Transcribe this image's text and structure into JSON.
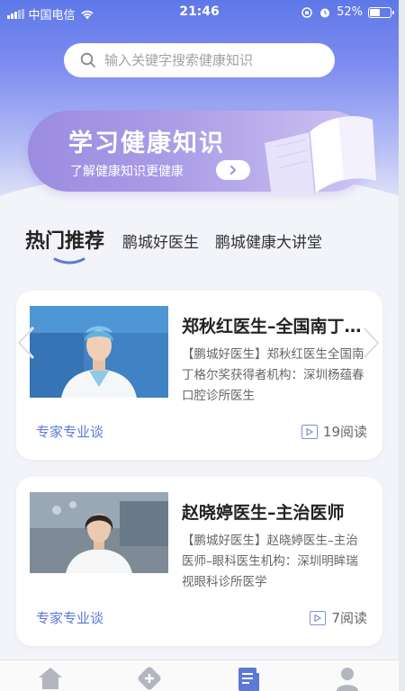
{
  "status_bar": {
    "carrier": "中国电信",
    "time": "21:46",
    "battery": "52%",
    "battery_level": 0.52
  },
  "search": {
    "placeholder": "输入关键字搜索健康知识"
  },
  "banner": {
    "title": "学习健康知识",
    "subtitle": "了解健康知识更健康"
  },
  "tabs": [
    {
      "label": "热门推荐",
      "active": true
    },
    {
      "label": "鹏城好医生",
      "active": false
    },
    {
      "label": "鹏城健康大讲堂",
      "active": false
    }
  ],
  "articles": [
    {
      "title": "郑秋红医生–全国南丁格尔奖获得者",
      "description": "【鹏城好医生】郑秋红医生全国南丁格尔奖获得者机构：深圳杨蕴春口腔诊所医生",
      "tag": "专家专业谈",
      "reads": "19阅读"
    },
    {
      "title": "赵晓婷医生–主治医师",
      "description": "【鹏城好医生】赵晓婷医生–主治医师–眼科医生机构：深圳明眸瑞视眼科诊所医学",
      "tag": "专家专业谈",
      "reads": "7阅读"
    }
  ],
  "colors": {
    "accent": "#5c79d6",
    "hero_top": "#5d78e8",
    "banner": "#a99be6"
  },
  "icons": {
    "tabbar": [
      "home-icon",
      "health-plus-icon",
      "article-list-icon",
      "profile-icon"
    ]
  }
}
